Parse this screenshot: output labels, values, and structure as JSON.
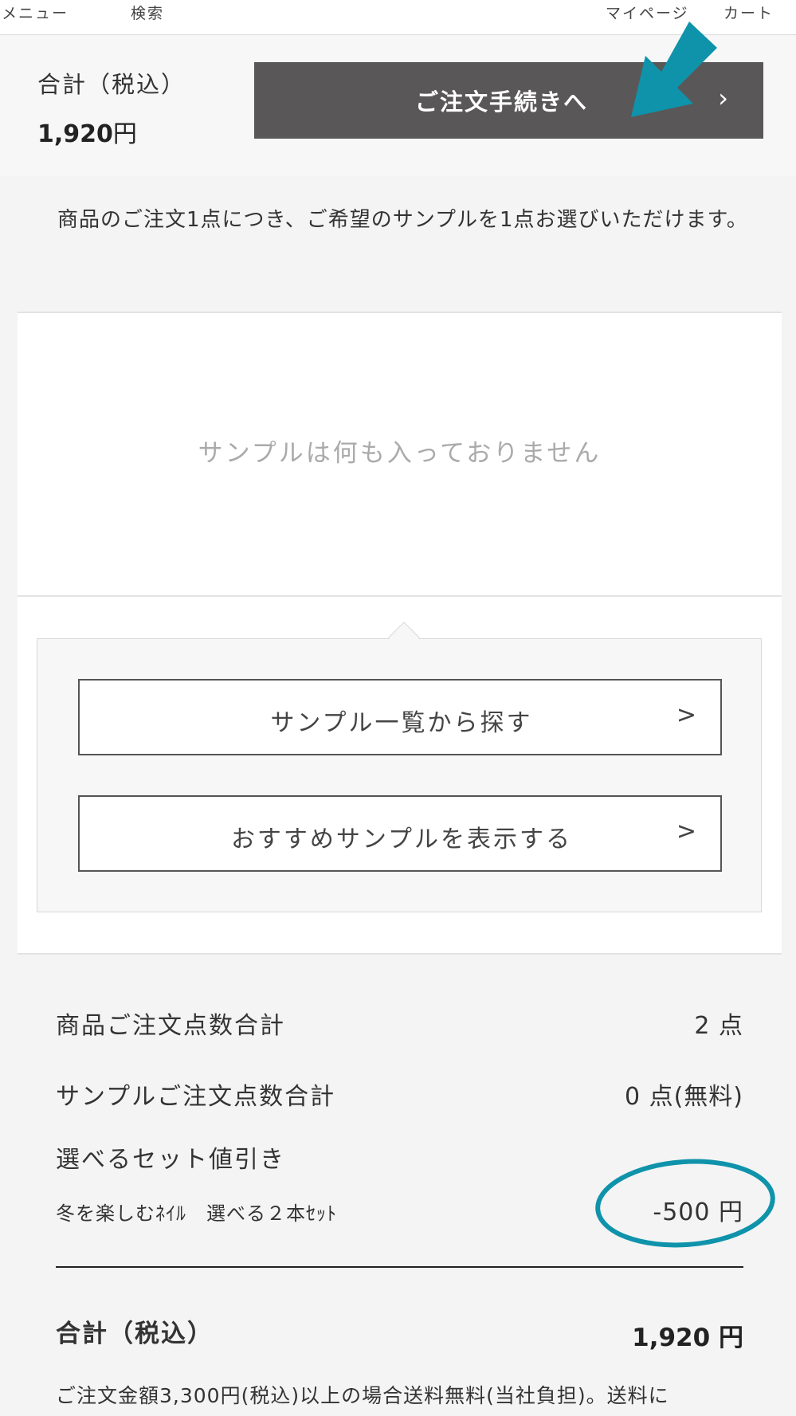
{
  "nav": {
    "menu": "メニュー",
    "search": "検索",
    "mypage": "マイページ",
    "cart": "カート"
  },
  "totalbar": {
    "label": "合計（税込）",
    "amount": "1,920",
    "currency": "円",
    "checkout_label": "ご注文手続きへ",
    "checkout_chevron": "›"
  },
  "notice": {
    "text": "商品のご注文1点につき、ご希望のサンプルを1点お選びいただけます。"
  },
  "samples": {
    "empty_text": "サンプルは何も入っておりません",
    "browse_label": "サンプル一覧から探す",
    "recommend_label": "おすすめサンプルを表示する",
    "chevron": ">"
  },
  "summary": {
    "items_label": "商品ご注文点数合計",
    "items_value": "2 点",
    "samples_label": "サンプルご注文点数合計",
    "samples_value": "0 点(無料)",
    "discount_label": "選べるセット値引き",
    "discount_detail": "冬を楽しむﾈｲﾙ　選べる２本ｾｯﾄ",
    "discount_value": "-500 円",
    "total_label": "合計（税込）",
    "total_amount": "1,920",
    "total_currency": " 円",
    "shipping_note": "ご注文金額3,300円(税込)以上の場合送料無料(当社負担)。送料に"
  },
  "colors": {
    "annotation": "#0f93ab",
    "checkout_bg": "#595757",
    "page_bg": "#f4f4f4"
  }
}
